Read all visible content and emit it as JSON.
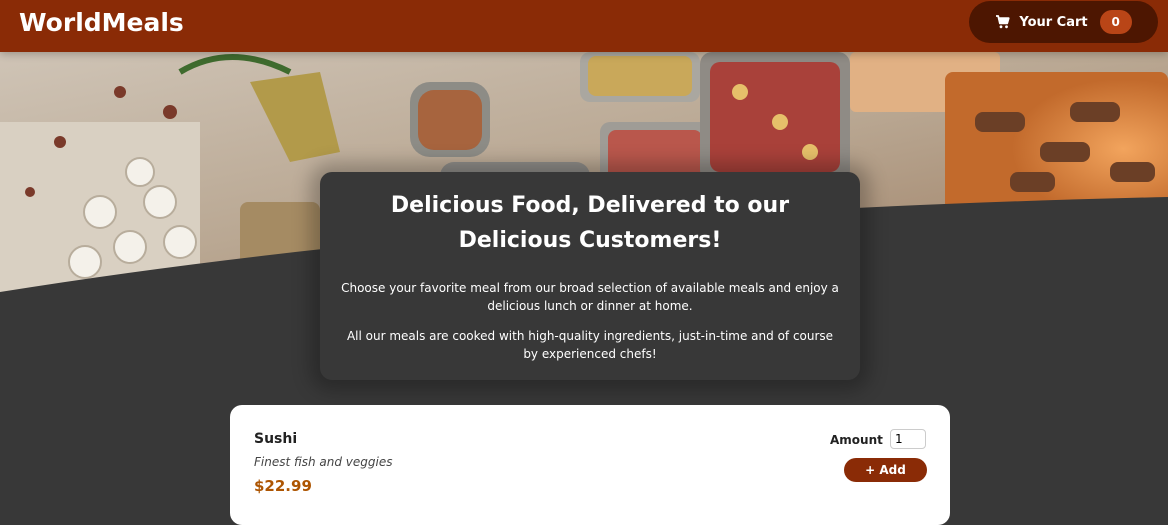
{
  "header": {
    "brand": "WorldMeals",
    "cart": {
      "label": "Your Cart",
      "count": "0",
      "icon": "cart-icon"
    }
  },
  "hero": {
    "image": "buffet table with assorted food platters"
  },
  "summary": {
    "title": "Delicious Food, Delivered to our Delicious Customers!",
    "paragraph1": "Choose your favorite meal from our broad selection of available meals and enjoy a delicious lunch or dinner at home.",
    "paragraph2": "All our meals are cooked with high-quality ingredients, just-in-time and of course by experienced chefs!"
  },
  "meals": [
    {
      "name": "Sushi",
      "description": "Finest fish and veggies",
      "price": "$22.99",
      "amount_label": "Amount",
      "amount_value": "1",
      "add_label": "+ Add"
    }
  ],
  "colors": {
    "header": "#8a2b06",
    "cart_button": "#4d1601",
    "badge": "#b94517",
    "background": "#383838",
    "price": "#ad5502"
  }
}
